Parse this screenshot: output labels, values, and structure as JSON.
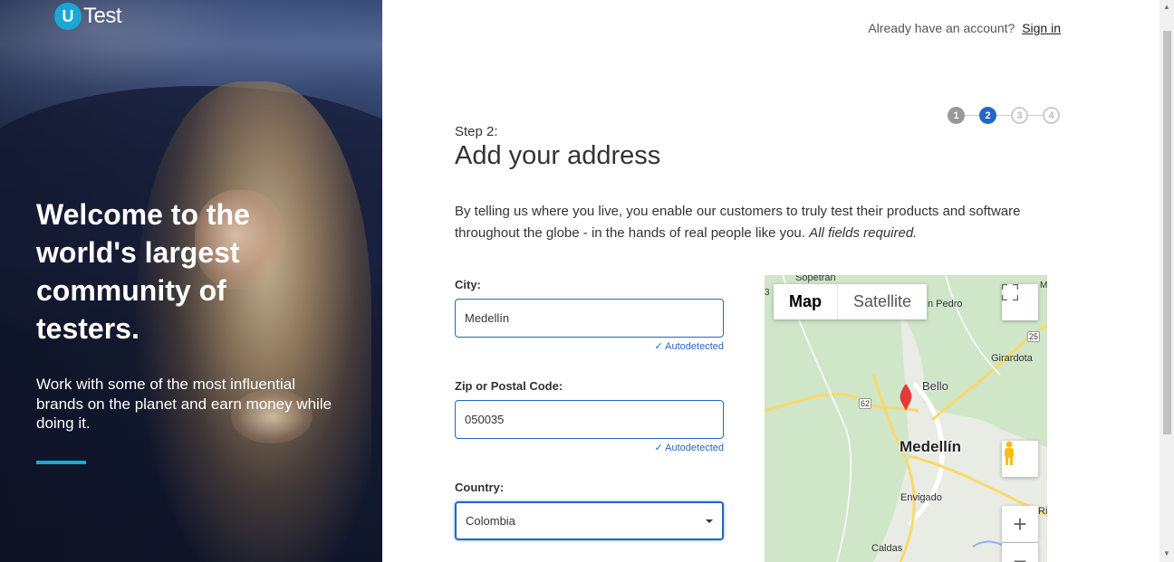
{
  "brand": {
    "logo_letter": "U",
    "logo_word": "Test",
    "accent": "#1ca7d6"
  },
  "hero": {
    "title": "Welcome to the world's largest community of testers.",
    "subtitle": "Work with some of the most influential brands on the planet and earn money while doing it."
  },
  "header": {
    "already": "Already have an account?",
    "signin": "Sign in"
  },
  "steps": {
    "items": [
      "1",
      "2",
      "3",
      "4"
    ],
    "active": 2
  },
  "form": {
    "step_label": "Step 2:",
    "title": "Add your address",
    "intro": "By telling us where you live, you enable our customers to truly test their products and software throughout the globe - in the hands of real people like you.",
    "intro_required": "All fields required.",
    "city_label": "City:",
    "city_value": "Medellín",
    "city_status": "Autodetected",
    "zip_label": "Zip or Postal Code:",
    "zip_value": "050035",
    "zip_status": "Autodetected",
    "country_label": "Country:",
    "country_value": "Colombia"
  },
  "map": {
    "type_map": "Map",
    "type_satellite": "Satellite",
    "zoom_in": "+",
    "zoom_out": "−",
    "labels": {
      "sopetran": "Sopetran",
      "san_pedro": "n Pedro",
      "girardota": "Girardota",
      "bello": "Bello",
      "medellin": "Medellín",
      "envigado": "Envigado",
      "caldas": "Caldas",
      "rio": "Rio",
      "road_25": "25",
      "road_62": "62",
      "edge_3": "3",
      "edge_m": "M"
    }
  },
  "colors": {
    "primary": "#2366c4",
    "step_done": "#999999"
  }
}
